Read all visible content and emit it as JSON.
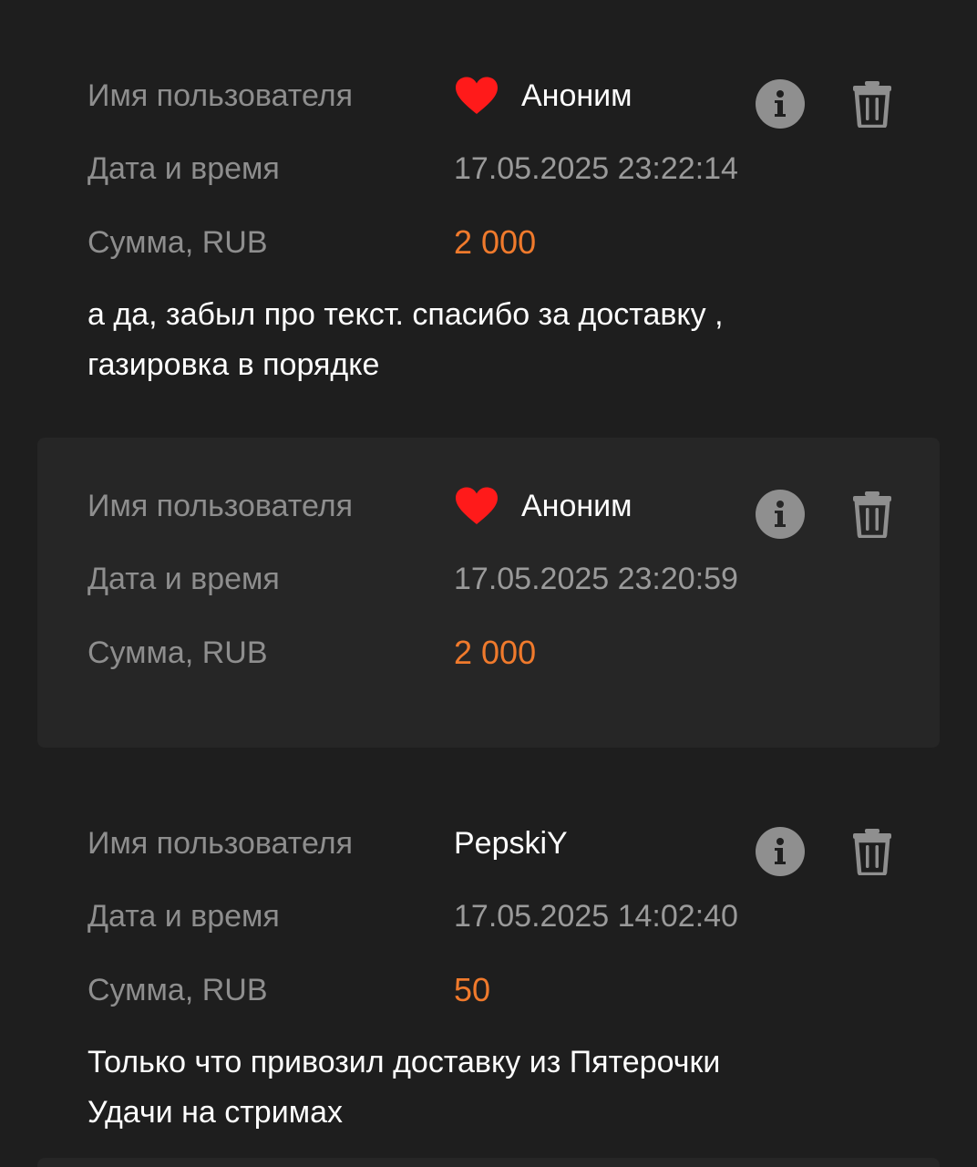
{
  "labels": {
    "username": "Имя пользователя",
    "datetime": "Дата и время",
    "amount": "Сумма, RUB"
  },
  "donations": [
    {
      "name": "Аноним",
      "anonymous": true,
      "icon": "heart-icon",
      "datetime": "17.05.2025 23:22:14",
      "amount": "2 000",
      "message_lines": [
        "а да, забыл про текст. спасибо за доставку ,",
        "газировка в порядке"
      ]
    },
    {
      "name": "Аноним",
      "anonymous": true,
      "icon": "heart-icon",
      "datetime": "17.05.2025 23:20:59",
      "amount": "2 000",
      "message_lines": []
    },
    {
      "name": "PepskiY",
      "anonymous": false,
      "datetime": "17.05.2025 14:02:40",
      "amount": "50",
      "message_lines": [
        "Только что привозил доставку из Пятерочки",
        "Удачи на стримах"
      ]
    }
  ],
  "colors": {
    "background": "#1e1e1e",
    "highlight_card": "#262626",
    "amount": "#f07a2c",
    "heart": "#ff1a1a",
    "label": "#8e8e8e",
    "icon": "#8f8f8f"
  }
}
